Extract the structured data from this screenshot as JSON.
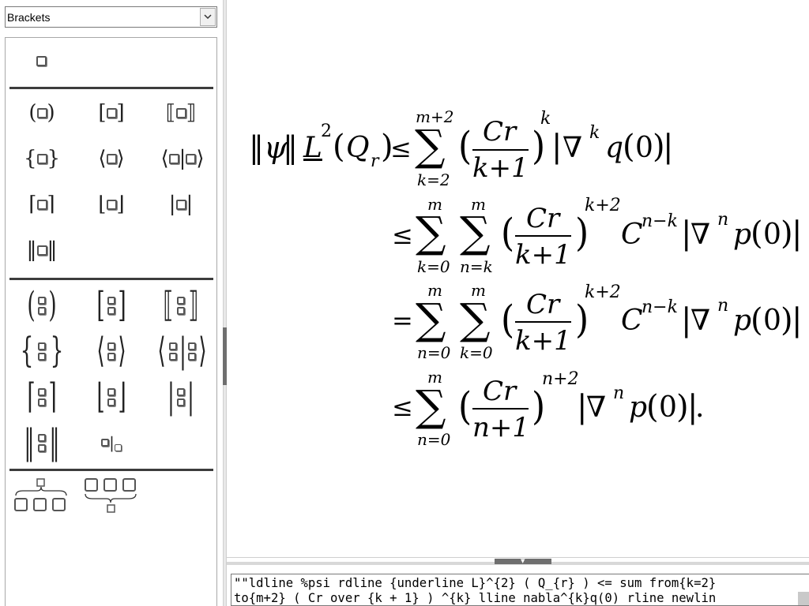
{
  "elements_panel": {
    "category": "Brackets",
    "sections": [
      [
        "placeholder"
      ],
      [
        "round-brackets",
        "square-brackets",
        "double-square-brackets",
        "braces",
        "angle-brackets",
        "operator-brackets",
        "upper-ceiling",
        "floor",
        "single-lines",
        "double-lines"
      ],
      [
        "round-brackets-scalable",
        "square-brackets-scalable",
        "double-square-brackets-scalable",
        "braces-scalable",
        "angle-brackets-scalable",
        "operator-brackets-scalable",
        "ceiling-scalable",
        "floor-scalable",
        "lines-scalable",
        "double-lines-scalable",
        "evaluated-at"
      ],
      [
        "overbrace",
        "underbrace"
      ]
    ]
  },
  "formula": {
    "line1": {
      "lhs_psi": "ψ",
      "lhs_L": "L",
      "lhs_exp": "2",
      "lhs_Q": "Q",
      "lhs_r": "r",
      "rel": "≤",
      "sum_upper": "m+2",
      "sum_lower": "k=2",
      "num": "Cr",
      "den": "k+1",
      "pow": "k",
      "nabla": "∇",
      "nabla_exp": "k",
      "func": "q",
      "arg": "0"
    },
    "line2": {
      "rel": "≤",
      "sum1_upper": "m",
      "sum1_lower": "k=0",
      "sum2_upper": "m",
      "sum2_lower": "n=k",
      "num": "Cr",
      "den": "k+1",
      "pow": "k+2",
      "C": "C",
      "C_exp": "n−k",
      "nabla": "∇",
      "nabla_exp": "n",
      "func": "p",
      "arg": "0"
    },
    "line3": {
      "rel": "=",
      "sum1_upper": "m",
      "sum1_lower": "n=0",
      "sum2_upper": "m",
      "sum2_lower": "k=0",
      "num": "Cr",
      "den": "k+1",
      "pow": "k+2",
      "C": "C",
      "C_exp": "n−k",
      "nabla": "∇",
      "nabla_exp": "n",
      "func": "p",
      "arg": "0"
    },
    "line4": {
      "rel": "≤",
      "sum_upper": "m",
      "sum_lower": "n=0",
      "num": "Cr",
      "den": "n+1",
      "pow": "n+2",
      "nabla": "∇",
      "nabla_exp": "n",
      "func": "p",
      "arg": "0",
      "end": "."
    }
  },
  "command_editor": {
    "line1": "\"\"ldline %psi rdline {underline L}^{2} ( Q_{r} ) <= sum from{k=2}",
    "line2": "to{m+2} ( Cr over {k + 1} ) ^{k} lline nabla^{k}q(0) rline newlin"
  }
}
